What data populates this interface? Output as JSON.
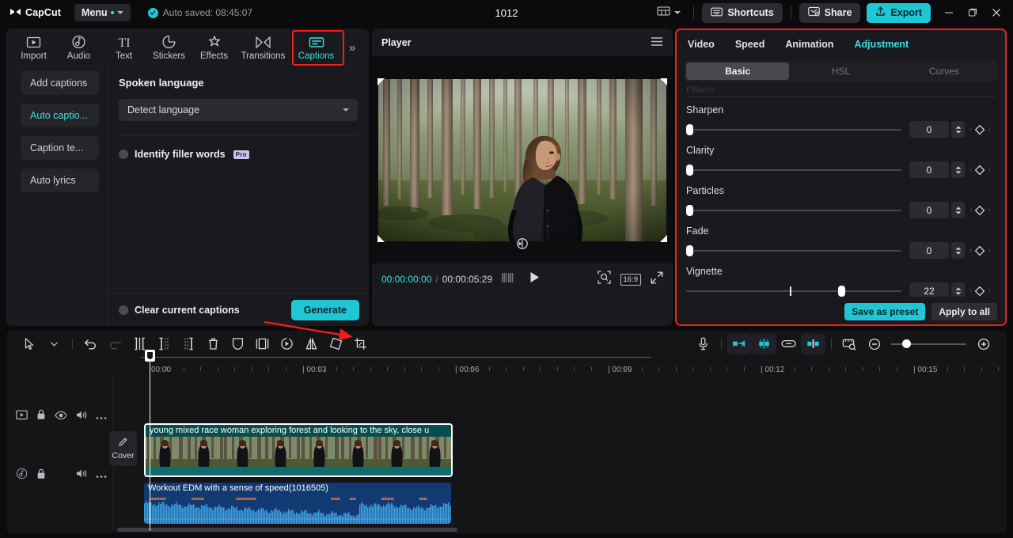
{
  "titlebar": {
    "app_name": "CapCut",
    "menu_label": "Menu",
    "autosave_text": "Auto saved: 08:45:07",
    "project_title": "1012",
    "shortcuts_label": "Shortcuts",
    "share_label": "Share",
    "export_label": "Export",
    "accent_color": "#1fc7d4"
  },
  "left_panel": {
    "tabs": [
      {
        "label": "Import",
        "icon": "import-icon",
        "active": false
      },
      {
        "label": "Audio",
        "icon": "audio-icon",
        "active": false
      },
      {
        "label": "Text",
        "icon": "text-icon",
        "active": false
      },
      {
        "label": "Stickers",
        "icon": "stickers-icon",
        "active": false
      },
      {
        "label": "Effects",
        "icon": "effects-icon",
        "active": false
      },
      {
        "label": "Transitions",
        "icon": "transitions-icon",
        "active": false
      },
      {
        "label": "Captions",
        "icon": "captions-icon",
        "active": true
      }
    ],
    "more_tabs_icon": "double-chevron-right-icon",
    "subnav": [
      {
        "label": "Add captions",
        "active": false
      },
      {
        "label": "Auto captio...",
        "active": true
      },
      {
        "label": "Caption te...",
        "active": false
      },
      {
        "label": "Auto lyrics",
        "active": false
      }
    ],
    "section_title": "Spoken language",
    "language_value": "Detect language",
    "filler_words_label": "Identify filler words",
    "pro_badge": "Pro",
    "clear_captions_label": "Clear current captions",
    "generate_label": "Generate",
    "highlight_color": "#f01d1d"
  },
  "player": {
    "title": "Player",
    "menu_icon": "hamburger-icon",
    "current_time": "00:00:00:00",
    "separator": "/",
    "total_time": "00:00:05:29",
    "frame_icon": "frames-icon",
    "play_icon": "play-icon",
    "magnifier_icon": "zoom-fit-icon",
    "ratio_label": "16:9",
    "fullscreen_icon": "fullscreen-icon",
    "rotate_icon": "rotate-icon"
  },
  "adjustment_panel": {
    "tabs": [
      {
        "label": "Video",
        "active": false
      },
      {
        "label": "Speed",
        "active": false
      },
      {
        "label": "Animation",
        "active": false
      },
      {
        "label": "Adjustment",
        "active": true
      }
    ],
    "segments": [
      {
        "label": "Basic",
        "active": true
      },
      {
        "label": "HSL",
        "active": false
      },
      {
        "label": "Curves",
        "active": false
      }
    ],
    "scrolled_off_label": "Effects",
    "sliders": [
      {
        "label": "Sharpen",
        "value": "0",
        "percent": 0,
        "has_center_tick": false
      },
      {
        "label": "Clarity",
        "value": "0",
        "percent": 0,
        "has_center_tick": false
      },
      {
        "label": "Particles",
        "value": "0",
        "percent": 0,
        "has_center_tick": false
      },
      {
        "label": "Fade",
        "value": "0",
        "percent": 0,
        "has_center_tick": false
      },
      {
        "label": "Vignette",
        "value": "22",
        "percent": 72,
        "has_center_tick": true
      }
    ],
    "save_preset_label": "Save as preset",
    "apply_all_label": "Apply to all",
    "keyframe_icon": "diamond-keyframe-icon"
  },
  "timeline": {
    "tools_left": [
      {
        "name": "select-tool-icon"
      },
      {
        "name": "chevron-down-icon"
      },
      {
        "name": "undo-icon"
      },
      {
        "name": "redo-icon"
      },
      {
        "name": "split-icon"
      },
      {
        "name": "trim-left-icon"
      },
      {
        "name": "trim-right-icon"
      },
      {
        "name": "delete-icon"
      },
      {
        "name": "mask-icon"
      },
      {
        "name": "freeze-frame-icon"
      },
      {
        "name": "reverse-icon"
      },
      {
        "name": "mirror-icon"
      },
      {
        "name": "rotate-icon"
      },
      {
        "name": "crop-icon"
      }
    ],
    "tools_right": [
      {
        "name": "record-voice-icon"
      },
      {
        "name": "auto-cut-icon"
      },
      {
        "name": "magnetic-snap-icon"
      },
      {
        "name": "link-icon"
      },
      {
        "name": "adsorption-icon"
      },
      {
        "name": "preview-axis-icon"
      },
      {
        "name": "zoom-out-icon"
      },
      {
        "name": "zoom-in-icon"
      }
    ],
    "ruler_labels": [
      "00:00",
      "00:03",
      "00:06",
      "00:09",
      "00:12",
      "00:15"
    ],
    "cover_label": "Cover",
    "video_track_controls": [
      "video-track-icon",
      "lock-icon",
      "eye-icon",
      "volume-icon",
      "more-icon"
    ],
    "audio_track_controls": [
      "audio-track-icon",
      "lock-icon",
      "volume-icon",
      "more-icon"
    ],
    "video_clip_title": "young mixed race woman exploring forest and looking to the sky, close u",
    "audio_clip_title": "Workout EDM with a sense of speed(1016505)",
    "video_clip_color": "#0e6c6c",
    "audio_clip_color": "#123a72"
  }
}
